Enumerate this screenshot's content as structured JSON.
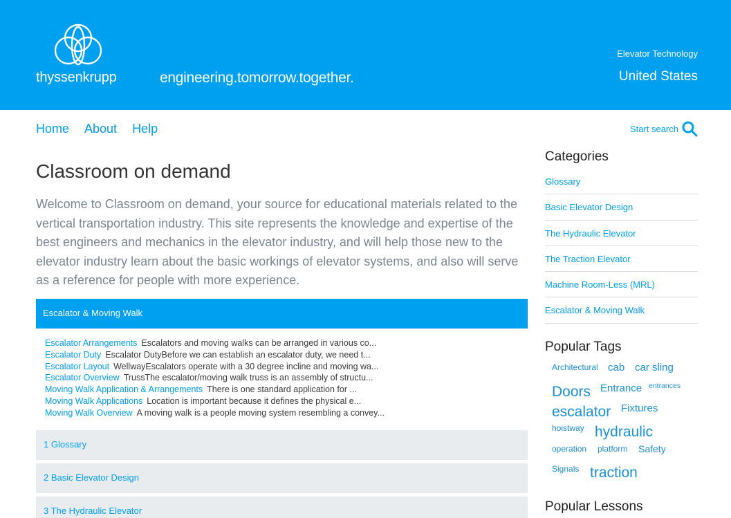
{
  "header": {
    "brand": "thyssenkrupp",
    "tagline": "engineering.tomorrow.together.",
    "division": "Elevator Technology",
    "country": "United States",
    "bg_color": "#00a0f0"
  },
  "nav": {
    "items": [
      "Home",
      "About",
      "Help"
    ],
    "search_label": "Start search",
    "search_icon": "search-icon"
  },
  "main": {
    "title": "Classroom on demand",
    "intro": "Welcome to Classroom on demand, your source for educational materials related to the vertical transportation industry. This site represents the knowledge and expertise of the best engineers and mechanics in the elevator industry, and will help those new to the elevator industry learn about the basic workings of elevator systems, and also will serve as a reference for people with more experience.",
    "active_section": "Escalator & Moving Walk",
    "lessons": [
      {
        "title": "Escalator Arrangements",
        "desc": "Escalators and moving walks can be arranged in various co..."
      },
      {
        "title": "Escalator Duty",
        "desc": "Escalator DutyBefore we can establish an escalator duty, we need t..."
      },
      {
        "title": "Escalator Layout",
        "desc": "WellwayEscalators operate with a 30 degree incline and moving wa..."
      },
      {
        "title": "Escalator Overview",
        "desc": "TrussThe escalator/moving walk truss is an assembly of structu..."
      },
      {
        "title": "Moving Walk Application & Arrangements",
        "desc": "There is one standard application for ..."
      },
      {
        "title": "Moving Walk Applications",
        "desc": "Location is important because it defines the physical e..."
      },
      {
        "title": "Moving Walk Overview",
        "desc": "A moving walk is a people moving system resembling a convey..."
      }
    ],
    "sections": [
      "1 Glossary",
      "2 Basic Elevator Design",
      "3 The Hydraulic Elevator"
    ]
  },
  "sidebar": {
    "categories_heading": "Categories",
    "categories": [
      "Glossary",
      "Basic Elevator Design",
      "The Hydraulic Elevator",
      "The Traction Elevator",
      "Machine Room-Less (MRL)",
      "Escalator & Moving Walk"
    ],
    "tags_heading": "Popular Tags",
    "tags": [
      "Architectural",
      "cab",
      "car sling",
      "Doors",
      "Entrance",
      "entrances",
      "escalator",
      "Fixtures",
      "hoistway",
      "hydraulic",
      "operation",
      "platform",
      "Safety",
      "Signals",
      "traction"
    ],
    "lessons_heading": "Popular Lessons"
  }
}
